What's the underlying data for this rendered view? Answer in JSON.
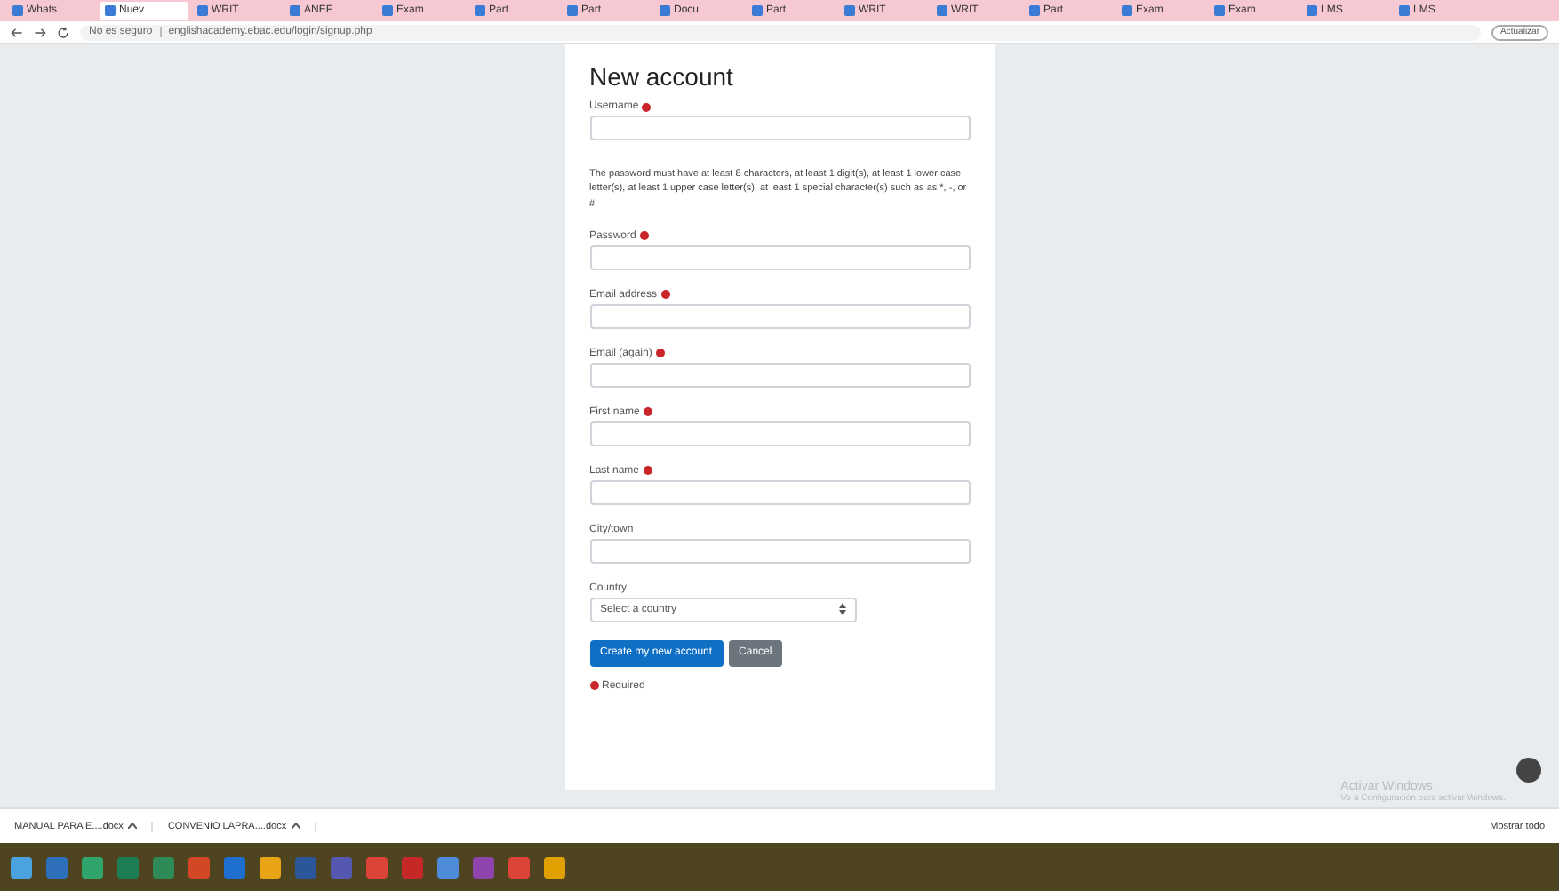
{
  "browser": {
    "tabs": [
      {
        "label": "Whats",
        "selected": false
      },
      {
        "label": "Nuev",
        "selected": true
      },
      {
        "label": "WRIT",
        "selected": false
      },
      {
        "label": "ANEF",
        "selected": false
      },
      {
        "label": "Exam",
        "selected": false
      },
      {
        "label": "Part",
        "selected": false
      },
      {
        "label": "Part",
        "selected": false
      },
      {
        "label": "Docu",
        "selected": false
      },
      {
        "label": "Part",
        "selected": false
      },
      {
        "label": "WRIT",
        "selected": false
      },
      {
        "label": "WRIT",
        "selected": false
      },
      {
        "label": "Part",
        "selected": false
      },
      {
        "label": "Exam",
        "selected": false
      },
      {
        "label": "Exam",
        "selected": false
      },
      {
        "label": "LMS",
        "selected": false
      },
      {
        "label": "LMS",
        "selected": false
      }
    ],
    "security": "No es seguro",
    "url": "englishacademy.ebac.edu/login/signup.php",
    "profile_button": "Actualizar"
  },
  "form": {
    "title": "New account",
    "fields": [
      {
        "kind": "text",
        "label": "Username",
        "required": true
      },
      {
        "kind": "note",
        "label": "The password must have at least 8 characters, at least 1 digit(s), at least 1 lower case letter(s), at least 1 upper case letter(s), at least 1 special character(s) such as as *, -, or #"
      },
      {
        "kind": "text",
        "label": "Password",
        "required": true
      },
      {
        "kind": "text",
        "label": "Email address",
        "required": true
      },
      {
        "kind": "text",
        "label": "Email (again)",
        "required": true
      },
      {
        "kind": "text",
        "label": "First name",
        "required": true
      },
      {
        "kind": "text",
        "label": "Last name",
        "required": true
      },
      {
        "kind": "text",
        "label": "City/town",
        "required": false
      },
      {
        "kind": "select",
        "label": "Country",
        "required": false,
        "value": "Select a country"
      }
    ],
    "buttons": [
      {
        "label": "Create my new account",
        "kind": "primary"
      },
      {
        "label": "Cancel",
        "kind": "secondary"
      }
    ],
    "required_note": "Required"
  },
  "watermark_os": {
    "title": "Activar Windows",
    "subtitle": "Ve a Configuración para activar Windows."
  },
  "downloads": {
    "items": [
      "MANUAL PARA E....docx",
      "CONVENIO LAPRA....docx"
    ],
    "show_all": "Mostrar todo"
  }
}
